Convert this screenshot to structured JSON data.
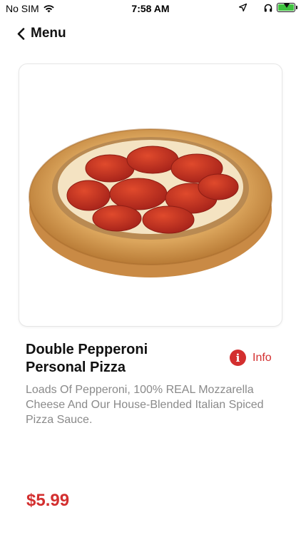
{
  "status_bar": {
    "carrier": "No SIM",
    "time": "7:58 AM",
    "icons": [
      "wifi-icon",
      "location-icon",
      "moon-icon",
      "headphones-icon",
      "battery-charging-icon"
    ]
  },
  "nav": {
    "back_label": "Menu"
  },
  "product": {
    "title": "Double Pepperoni Personal Pizza",
    "info_label": "Info",
    "description": "Loads Of Pepperoni, 100% REAL Mozzarella Cheese And Our House-Blended Italian Spiced Pizza Sauce.",
    "price": "$5.99",
    "image_subject": "pan pizza with pepperoni"
  },
  "colors": {
    "accent": "#d32f2f",
    "description_text": "#8a8a8a",
    "battery_fill": "#3fc23f"
  }
}
